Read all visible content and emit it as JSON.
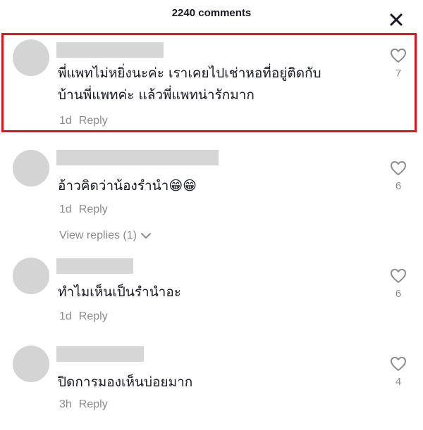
{
  "header": {
    "title": "2240 comments",
    "close_icon": "close-icon"
  },
  "comments": [
    {
      "lines": [
        "พี่แพทไม่หยิ่งนะค่ะ  เราเคยไปเช่าหอที่อยู่ติดกับ",
        "บ้านพี่แพทค่ะ  แล้วพี่แพทน่ารักมาก"
      ],
      "time": "1d",
      "reply_label": "Reply",
      "likes": "7",
      "highlighted": true
    },
    {
      "lines": [
        "อ้าวคิดว่าน้องรำนำ😁😁"
      ],
      "time": "1d",
      "reply_label": "Reply",
      "likes": "6",
      "view_replies": "View replies (1)"
    },
    {
      "lines": [
        "ทำไมเห็นเป็นรำนำอะ"
      ],
      "time": "1d",
      "reply_label": "Reply",
      "likes": "6"
    },
    {
      "lines": [
        "ปิดการมองเห็นบ่อยมาก"
      ],
      "time": "3h",
      "reply_label": "Reply",
      "likes": "4"
    }
  ],
  "colors": {
    "highlight_border": "#e0141e",
    "muted_text": "#8a8b91",
    "avatar_placeholder": "#d4d4d4"
  },
  "icons": [
    "close-icon",
    "heart-outline-icon",
    "chevron-down-icon"
  ]
}
